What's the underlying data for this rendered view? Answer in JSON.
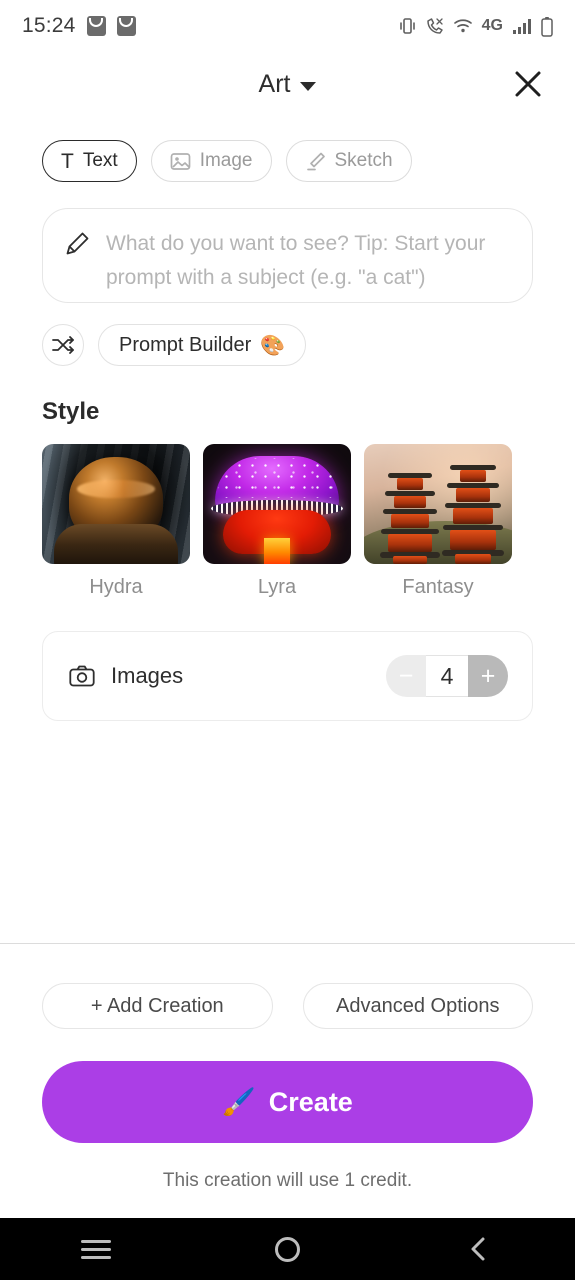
{
  "statusbar": {
    "time": "15:24",
    "left_icons": [
      "shopping-bag-notification",
      "shopping-bag-notification"
    ],
    "right_icons": [
      "vibrate-icon",
      "call-icon",
      "wifi-icon",
      "signal-bars-icon",
      "battery-icon"
    ],
    "network_label": "4G"
  },
  "header": {
    "title": "Art",
    "caret": "chevron-down-icon",
    "close": "close-icon"
  },
  "tabs": [
    {
      "label": "Text",
      "icon": "text-icon",
      "active": true
    },
    {
      "label": "Image",
      "icon": "image-icon",
      "active": false
    },
    {
      "label": "Sketch",
      "icon": "sketch-pencil-icon",
      "active": false
    }
  ],
  "prompt": {
    "icon": "pencil-icon",
    "placeholder": "What do you want to see? Tip: Start your prompt with a subject (e.g. \"a cat\")",
    "value": ""
  },
  "prompt_tools": {
    "shuffle_icon": "shuffle-icon",
    "builder_label": "Prompt Builder",
    "builder_emoji": "🎨"
  },
  "style": {
    "heading": "Style",
    "options": [
      {
        "label": "Hydra"
      },
      {
        "label": "Lyra"
      },
      {
        "label": "Fantasy"
      }
    ]
  },
  "images": {
    "icon": "camera-icon",
    "label": "Images",
    "count": "4",
    "minus_label": "−",
    "plus_label": "+"
  },
  "actions": {
    "add_creation": "+ Add Creation",
    "advanced_options": "Advanced Options",
    "create_label": "Create",
    "create_emoji": "🖌️",
    "credit_note": "This creation will use 1 credit."
  },
  "colors": {
    "create_button": "#ab3ee6",
    "active_tab": "#2b2b2b",
    "muted_text": "#9a9a9a",
    "navbar": "#000000"
  },
  "navbar": {
    "recents": "recents-icon",
    "home": "home-icon",
    "back": "back-icon"
  }
}
